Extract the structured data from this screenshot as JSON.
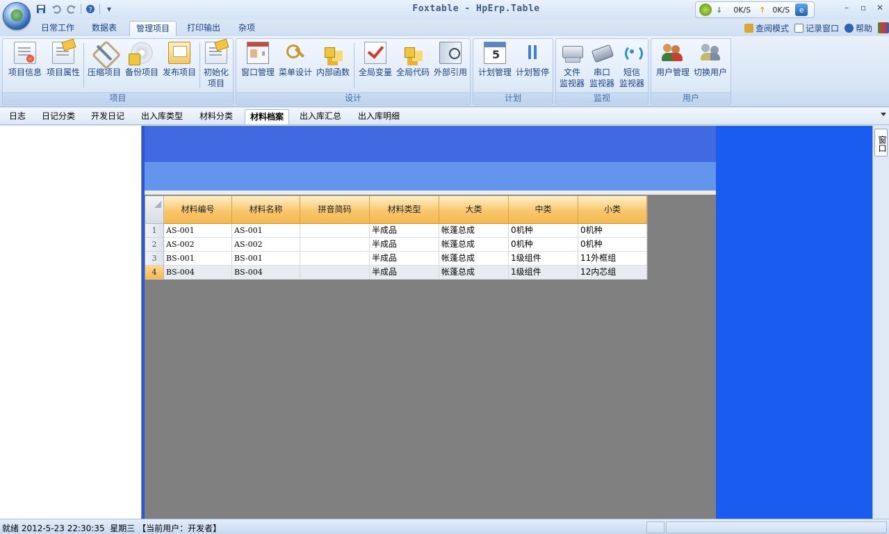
{
  "window": {
    "title": "Foxtable - HpErp.Table",
    "min_label": "–",
    "max_label": "▫",
    "close_label": "✕"
  },
  "netmon": {
    "down_arrow": "↓",
    "up_arrow": "↑",
    "down_rate": "0K/S",
    "up_rate": "0K/S"
  },
  "quick_access": {
    "save_icon": "save-icon",
    "undo_icon": "undo-icon",
    "redo_icon": "redo-icon",
    "help_icon": "help-icon",
    "more": "▾"
  },
  "menu_tabs": [
    "日常工作",
    "数据表",
    "管理项目",
    "打印输出",
    "杂项"
  ],
  "active_menu_tab": "管理项目",
  "right_links": {
    "view_mode": "查阅模式",
    "log_window": "记录窗口",
    "help": "帮助"
  },
  "ribbon": {
    "groups": [
      {
        "label": "项目",
        "buttons": [
          {
            "label": "项目信息",
            "icon": "certificate-icon"
          },
          {
            "label": "项目属性",
            "icon": "properties-icon"
          },
          {
            "label": "压缩项目",
            "icon": "compress-icon"
          },
          {
            "label": "备份项目",
            "icon": "backup-disk-icon"
          },
          {
            "label": "发布项目",
            "icon": "publish-icon"
          },
          {
            "label": "初始化",
            "label2": "项目",
            "icon": "initialize-icon"
          }
        ]
      },
      {
        "label": "设计",
        "buttons": [
          {
            "label": "窗口管理",
            "icon": "window-manager-icon"
          },
          {
            "label": "菜单设计",
            "icon": "menu-design-icon"
          },
          {
            "label": "内部函数",
            "icon": "function-icon"
          },
          {
            "label": "全局变量",
            "icon": "global-variable-icon"
          },
          {
            "label": "全局代码",
            "icon": "global-code-icon"
          },
          {
            "label": "外部引用",
            "icon": "reference-icon"
          }
        ]
      },
      {
        "label": "计划",
        "buttons": [
          {
            "label": "计划管理",
            "icon": "calendar-icon"
          },
          {
            "label": "计划暂停",
            "icon": "pause-icon"
          }
        ]
      },
      {
        "label": "监视",
        "buttons": [
          {
            "label": "文件",
            "label2": "监视器",
            "icon": "file-monitor-icon"
          },
          {
            "label": "串口",
            "label2": "监视器",
            "icon": "serial-monitor-icon"
          },
          {
            "label": "短信",
            "label2": "监视器",
            "icon": "sms-monitor-icon"
          }
        ]
      },
      {
        "label": "用户",
        "buttons": [
          {
            "label": "用户管理",
            "icon": "user-manager-icon"
          },
          {
            "label": "切换用户",
            "icon": "switch-user-icon"
          }
        ]
      }
    ]
  },
  "sheet_tabs": [
    "日志",
    "日记分类",
    "开发日记",
    "出入库类型",
    "材料分类",
    "材料档案",
    "出入库汇总",
    "出入库明细"
  ],
  "active_sheet_tab": "材料档案",
  "side_tab": "窗口",
  "grid": {
    "columns": [
      "材料编号",
      "材料名称",
      "拼音简码",
      "材料类型",
      "大类",
      "中类",
      "小类"
    ],
    "rows": [
      {
        "n": "1",
        "cells": [
          "AS-001",
          "AS-001",
          "",
          "半成品",
          "帐蓬总成",
          "0机种",
          "0机种"
        ]
      },
      {
        "n": "2",
        "cells": [
          "AS-002",
          "AS-002",
          "",
          "半成品",
          "帐蓬总成",
          "0机种",
          "0机种"
        ]
      },
      {
        "n": "3",
        "cells": [
          "BS-001",
          "BS-001",
          "",
          "半成品",
          "帐蓬总成",
          "1级组件",
          "11外框组"
        ]
      },
      {
        "n": "4",
        "cells": [
          "BS-004",
          "BS-004",
          "",
          "半成品",
          "帐蓬总成",
          "1级组件",
          "12内芯组"
        ]
      }
    ],
    "selected_row": "4"
  },
  "status": {
    "text": "就绪 2012-5-23 22:30:35  星期三 【当前用户：开发者】"
  }
}
